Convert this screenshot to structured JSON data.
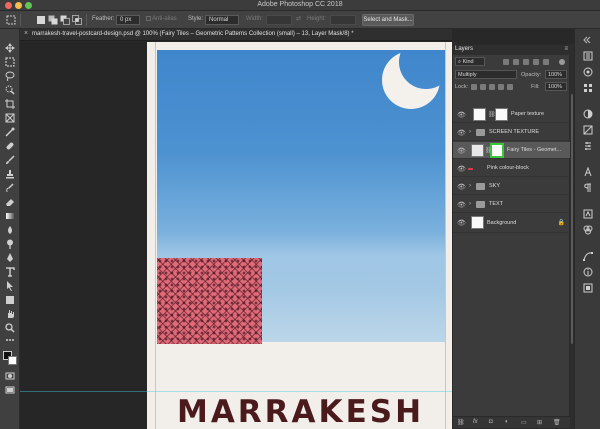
{
  "app": {
    "title": "Adobe Photoshop CC 2018"
  },
  "options_bar": {
    "feather_label": "Feather:",
    "feather_value": "0 px",
    "anti_alias_label": "Anti-alias",
    "style_label": "Style:",
    "style_value": "Normal",
    "width_label": "Width:",
    "height_label": "Height:",
    "select_mask_button": "Select and Mask..."
  },
  "document": {
    "tab_title": "marrakesh-travel-postcard-design.psd @ 100% (Fairy Tiles – Geometric Patterns Collection (small) – 13, Layer Mask/8) *",
    "close_glyph": "×",
    "postcard_title": "MARRAKESH"
  },
  "layers_panel": {
    "tab_label": "Layers",
    "filter_label": "Kind",
    "blend_mode": "Multiply",
    "opacity_label": "Opacity:",
    "opacity_value": "100%",
    "lock_label": "Lock:",
    "fill_label": "Fill:",
    "fill_value": "100%",
    "layers": [
      {
        "name": "Paper texture",
        "type": "layer"
      },
      {
        "name": "SCREEN TEXTURE",
        "type": "group"
      },
      {
        "name": "Fairy Tiles - Geomet...",
        "type": "layer"
      },
      {
        "name": "Pink colour-block",
        "type": "layer"
      },
      {
        "name": "SKY",
        "type": "group"
      },
      {
        "name": "TEXT",
        "type": "group"
      },
      {
        "name": "Background",
        "type": "layer"
      }
    ],
    "footer_icons": [
      "link-icon",
      "fx-icon",
      "mask-icon",
      "adjustment-icon",
      "folder-icon",
      "new-layer-icon",
      "trash-icon"
    ],
    "footer_fx": "fx"
  },
  "colors": {
    "accent_selected_mask": "#3cc43c",
    "pink_block": "#e06a78",
    "title_text": "#4a1a1c"
  }
}
